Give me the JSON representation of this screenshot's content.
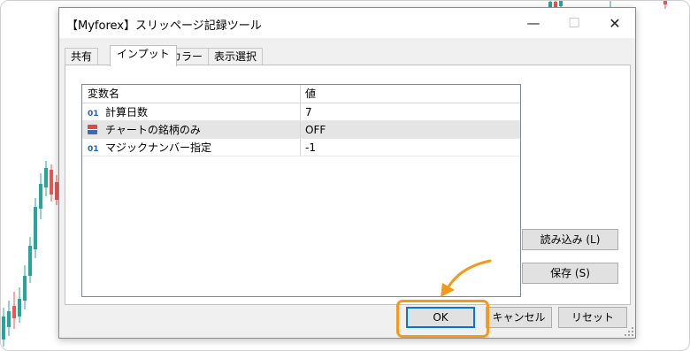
{
  "dialog": {
    "title": "【Myforex】スリッページ記録ツール",
    "window_controls": {
      "minimize": "—",
      "maximize": "☐",
      "close": "✕"
    }
  },
  "tabs": [
    "共有",
    "インプット",
    "カラー",
    "表示選択"
  ],
  "active_tab": "インプット",
  "table": {
    "columns": [
      "変数名",
      "値"
    ],
    "rows": [
      {
        "icon": "int-type-icon",
        "type_label": "01",
        "name": "計算日数",
        "value": "7"
      },
      {
        "icon": "bool-type-icon",
        "type_label": "",
        "name": "チャートの銘柄のみ",
        "value": "OFF"
      },
      {
        "icon": "int-type-icon",
        "type_label": "01",
        "name": "マジックナンバー指定",
        "value": "-1"
      }
    ]
  },
  "buttons": {
    "load": "読み込み (L)",
    "save": "保存 (S)",
    "ok": "OK",
    "cancel": "キャンセル",
    "reset": "リセット"
  },
  "colors": {
    "highlight": "#f39a1c",
    "candle_up": "#26a69a",
    "candle_down": "#ef5350",
    "focus": "#0078d7"
  }
}
